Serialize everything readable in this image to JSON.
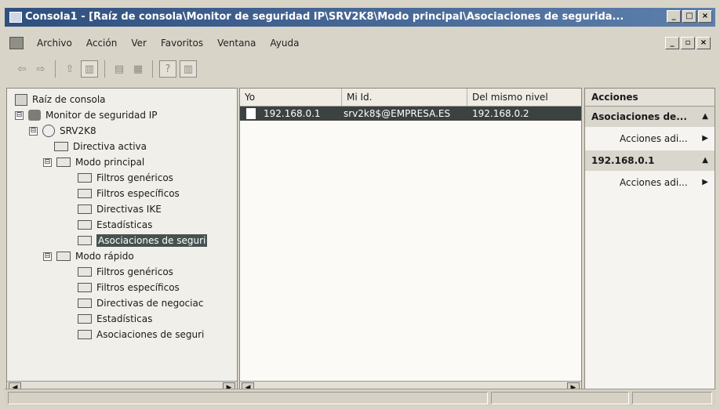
{
  "window": {
    "title": "Consola1 - [Raíz de consola\\Monitor de seguridad IP\\SRV2K8\\Modo principal\\Asociaciones de segurida..."
  },
  "window_buttons": [
    "_",
    "□",
    "×"
  ],
  "child_buttons": [
    "_",
    "▫",
    "×"
  ],
  "menu": [
    "Archivo",
    "Acción",
    "Ver",
    "Favoritos",
    "Ventana",
    "Ayuda"
  ],
  "toolbar_icons": [
    "back-icon",
    "forward-icon",
    "up-icon",
    "show-hide-tree-icon",
    "properties-icon",
    "export-list-icon",
    "help-icon",
    "show-hide-action-pane-icon"
  ],
  "tree": {
    "root": "Raíz de consola",
    "monitor": "Monitor de seguridad IP",
    "server": "SRV2K8",
    "active_policy": "Directiva activa",
    "main_mode": {
      "label": "Modo principal",
      "children": [
        "Filtros genéricos",
        "Filtros específicos",
        "Directivas IKE",
        "Estadísticas",
        "Asociaciones de seguri"
      ]
    },
    "quick_mode": {
      "label": "Modo rápido",
      "children": [
        "Filtros genéricos",
        "Filtros específicos",
        "Directivas de negociac",
        "Estadísticas",
        "Asociaciones de seguri"
      ]
    },
    "selected": "Modo principal > Asociaciones de seguri",
    "expanders": [
      "⊟",
      "⊟",
      "⊟",
      "⊟"
    ]
  },
  "list": {
    "columns": [
      "Yo",
      "Mi Id.",
      "Del mismo nivel"
    ],
    "rows": [
      {
        "me": "192.168.0.1",
        "my_id": "srv2k8$@EMPRESA.ES",
        "peer": "192.168.0.2"
      }
    ]
  },
  "actions": {
    "header": "Acciones",
    "sections": [
      {
        "title": "Asociaciones de...",
        "item": "Acciones adi..."
      },
      {
        "title": "192.168.0.1",
        "item": "Acciones adi..."
      }
    ]
  },
  "colors": {
    "title_bar": "#2f4f7f",
    "selection": "#3b4240",
    "panel_bg": "#f1efe9"
  }
}
